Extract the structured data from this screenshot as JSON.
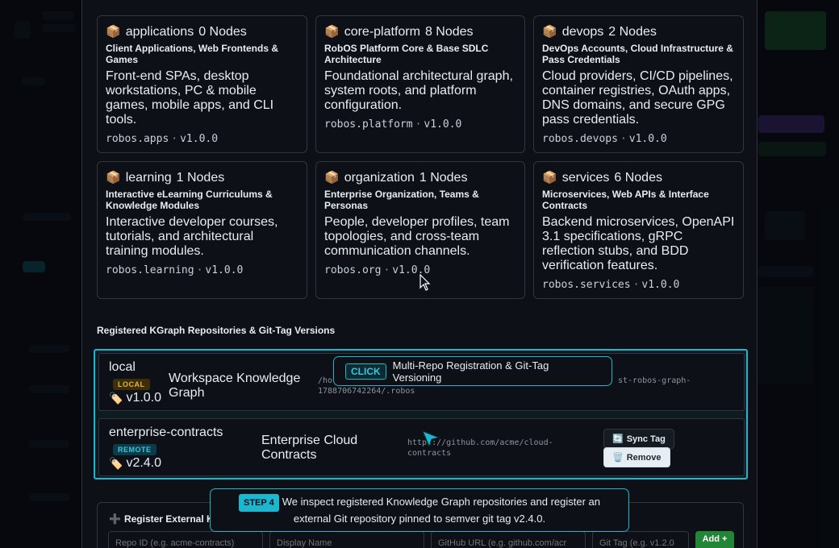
{
  "modules": [
    {
      "name": "applications",
      "count": "0 Nodes",
      "subtitle": "Client Applications, Web Frontends & Games",
      "description": "Front-end SPAs, desktop workstations, PC & mobile games, mobile apps, and CLI tools.",
      "package": "robos.apps",
      "version": "v1.0.0"
    },
    {
      "name": "core-platform",
      "count": "8 Nodes",
      "subtitle": "RobOS Platform Core & Base SDLC Architecture",
      "description": "Foundational architectural graph, system roots, and platform configuration.",
      "package": "robos.platform",
      "version": "v1.0.0"
    },
    {
      "name": "devops",
      "count": "2 Nodes",
      "subtitle": "DevOps Accounts, Cloud Infrastructure & Pass Credentials",
      "description": "Cloud providers, CI/CD pipelines, container registries, OAuth apps, DNS domains, and secure GPG pass credentials.",
      "package": "robos.devops",
      "version": "v1.0.0"
    },
    {
      "name": "learning",
      "count": "1 Nodes",
      "subtitle": "Interactive eLearning Curriculums & Knowledge Modules",
      "description": "Interactive developer courses, tutorials, and architectural training modules.",
      "package": "robos.learning",
      "version": "v1.0.0"
    },
    {
      "name": "organization",
      "count": "1 Nodes",
      "subtitle": "Enterprise Organization, Teams & Personas",
      "description": "People, developer profiles, team topologies, and cross-team communication channels.",
      "package": "robos.org",
      "version": "v1.0.0"
    },
    {
      "name": "services",
      "count": "6 Nodes",
      "subtitle": "Microservices, Web APIs & Interface Contracts",
      "description": "Backend microservices, OpenAPI 3.1 specifications, gRPC reflection stubs, and BDD verification features.",
      "package": "robos.services",
      "version": "v1.0.0"
    }
  ],
  "repositories_section": {
    "title": "Registered KGraph Repositories & Git-Tag Versions"
  },
  "repositories": [
    {
      "id": "local",
      "badge": "LOCAL",
      "tag": "v1.0.0",
      "name": "Workspace Knowledge Graph",
      "url_start": "/ho",
      "url_end": "st-robos-graph-",
      "url_line2": "1788706742264/.robos"
    },
    {
      "id": "enterprise-contracts",
      "badge": "REMOTE",
      "tag": "v2.4.0",
      "name": "Enterprise Cloud Contracts",
      "url": "https://github.com/acme/cloud-contracts",
      "sync_label": "Sync Tag",
      "remove_label": "Remove"
    }
  ],
  "tooltip_click": {
    "pill": "CLICK",
    "text": "Multi-Repo Registration & Git-Tag Versioning"
  },
  "tooltip_step": {
    "pill": "STEP 4",
    "text": "We inspect registered Knowledge Graph repositories and register an external Git repository pinned to semver git tag v2.4.0."
  },
  "register_form": {
    "title": "Register External K",
    "fields": {
      "repo_id_placeholder": "Repo ID (e.g. acme-contracts)",
      "display_name_placeholder": "Display Name",
      "github_url_placeholder": "GitHub URL (e.g. github.com/acr",
      "git_tag_placeholder": "Git Tag (e.g. v1.2.0"
    },
    "add_label": "Add +"
  },
  "icons": {
    "package": "package-icon",
    "tag": "tag-icon",
    "sync": "sync-icon",
    "trash": "trash-icon",
    "plus": "plus-icon"
  },
  "colors": {
    "accent": "#1bb6cf",
    "local_badge": "#e3b341",
    "remote_badge": "#39c5dc",
    "add_button": "#238636"
  }
}
